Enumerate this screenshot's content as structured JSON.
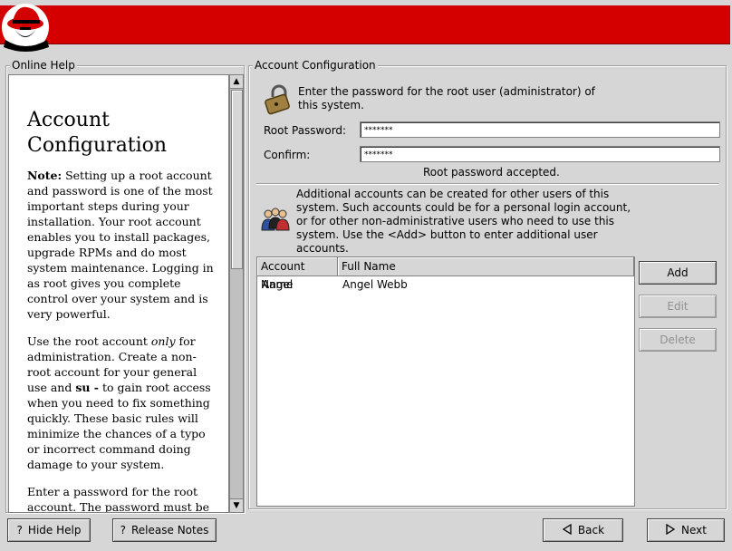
{
  "help": {
    "legend": "Online Help",
    "title_line1": "Account",
    "title_line2": "Configuration",
    "p1_bold": "Note:",
    "p1_rest": " Setting up a root account and password is one of the most important steps during your installation. Your root account enables you to install packages, upgrade RPMs and do most system maintenance. Logging in as root gives you complete control over your system and is very powerful.",
    "p2_a": "Use the root account ",
    "p2_em": "only",
    "p2_b": " for administration. Create a non-root account for your general use and ",
    "p2_bold": "su -",
    "p2_c": " to gain root access when you need to fix something quickly. These basic rules will minimize the chances of a typo or incorrect command doing damage to your system.",
    "p3": "Enter a password for the root account. The password must be at least six characters in length."
  },
  "account": {
    "legend": "Account Configuration",
    "root_prompt": "Enter the password for the root user (administrator) of this system.",
    "root_password_label": "Root Password:",
    "root_password_value": "*******",
    "confirm_label": "Confirm:",
    "confirm_value": "*******",
    "status": "Root password accepted.",
    "additional_text": "Additional accounts can be created for other users of this system. Such accounts could be for a personal login account, or for other non-administrative users who need to use this system. Use the <Add> button to enter additional user accounts.",
    "columns": [
      "Account Name",
      "Full Name"
    ],
    "rows": [
      {
        "account": "Angel",
        "full": "Angel Webb"
      }
    ],
    "add_label": "Add",
    "edit_label": "Edit",
    "delete_label": "Delete"
  },
  "footer": {
    "hide_help": "Hide Help",
    "release_notes": "Release Notes",
    "back": "Back",
    "next": "Next"
  },
  "colors": {
    "banner_red": "#d40000",
    "background": "#d6d6d6"
  },
  "icons": [
    "redhat-logo",
    "scrollbar-up-icon",
    "scrollbar-down-icon",
    "lock-icon",
    "users-icon",
    "help-icon",
    "back-arrow-icon",
    "next-arrow-icon"
  ]
}
